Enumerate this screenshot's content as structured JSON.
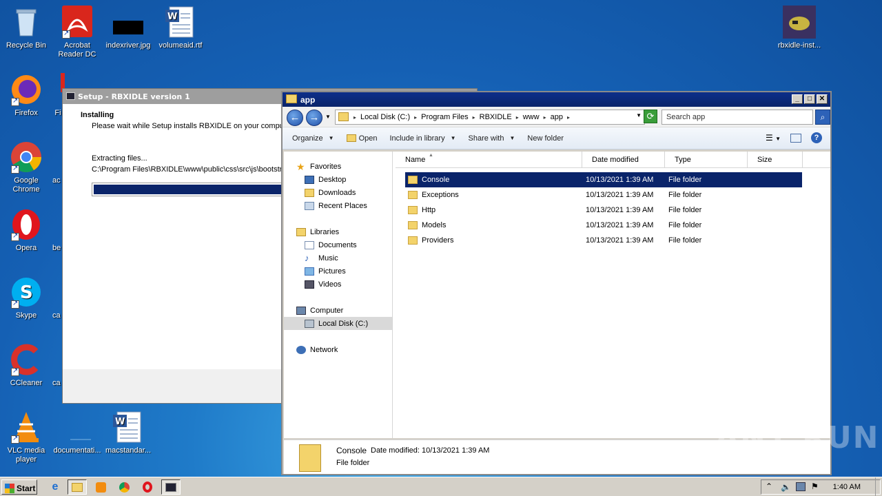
{
  "desktop_icons": [
    {
      "id": "recycle",
      "label": "Recycle Bin",
      "icon": "recycle-bin-icon"
    },
    {
      "id": "acrobat",
      "label": "Acrobat Reader DC",
      "icon": "acrobat-icon"
    },
    {
      "id": "indexriver",
      "label": "indexriver.jpg",
      "icon": "image-file-icon"
    },
    {
      "id": "volumeaid",
      "label": "volumeaid.rtf",
      "icon": "word-doc-icon"
    },
    {
      "id": "rbxidle",
      "label": "rbxidle-inst...",
      "icon": "installer-icon"
    },
    {
      "id": "firefox",
      "label": "Firefox",
      "icon": "firefox-icon"
    },
    {
      "id": "chrome",
      "label": "Google Chrome",
      "icon": "chrome-icon"
    },
    {
      "id": "opera",
      "label": "Opera",
      "icon": "opera-icon"
    },
    {
      "id": "skype",
      "label": "Skype",
      "icon": "skype-icon"
    },
    {
      "id": "ccleaner",
      "label": "CCleaner",
      "icon": "ccleaner-icon"
    },
    {
      "id": "vlc",
      "label": "VLC media player",
      "icon": "vlc-icon"
    },
    {
      "id": "documentati",
      "label": "documentati...",
      "icon": "file-icon"
    },
    {
      "id": "macstandar",
      "label": "macstandar...",
      "icon": "word-doc-icon"
    },
    {
      "id": "partial_fi",
      "label": "Fi"
    },
    {
      "id": "partial_ac",
      "label": "ac"
    },
    {
      "id": "partial_be",
      "label": "be"
    },
    {
      "id": "partial_ca1",
      "label": "ca"
    },
    {
      "id": "partial_ca2",
      "label": "ca"
    }
  ],
  "setup": {
    "title": "Setup - RBXIDLE version 1",
    "heading": "Installing",
    "subheading": "Please wait while Setup installs RBXIDLE on your computer.",
    "status": "Extracting files...",
    "current_file": "C:\\Program Files\\RBXIDLE\\www\\public\\css\\src\\js\\bootstrap",
    "progress": 0.98
  },
  "explorer": {
    "title": "app",
    "breadcrumbs": [
      "Local Disk (C:)",
      "Program Files",
      "RBXIDLE",
      "www",
      "app"
    ],
    "search_placeholder": "Search app",
    "toolbar": {
      "organize": "Organize",
      "open": "Open",
      "include": "Include in library",
      "share": "Share with",
      "new_folder": "New folder"
    },
    "nav": {
      "favorites": "Favorites",
      "desktop": "Desktop",
      "downloads": "Downloads",
      "recent": "Recent Places",
      "libraries": "Libraries",
      "documents": "Documents",
      "music": "Music",
      "pictures": "Pictures",
      "videos": "Videos",
      "computer": "Computer",
      "local_disk": "Local Disk (C:)",
      "network": "Network"
    },
    "columns": {
      "name": "Name",
      "date": "Date modified",
      "type": "Type",
      "size": "Size"
    },
    "files": [
      {
        "name": "Console",
        "date": "10/13/2021 1:39 AM",
        "type": "File folder"
      },
      {
        "name": "Exceptions",
        "date": "10/13/2021 1:39 AM",
        "type": "File folder"
      },
      {
        "name": "Http",
        "date": "10/13/2021 1:39 AM",
        "type": "File folder"
      },
      {
        "name": "Models",
        "date": "10/13/2021 1:39 AM",
        "type": "File folder"
      },
      {
        "name": "Providers",
        "date": "10/13/2021 1:39 AM",
        "type": "File folder"
      }
    ],
    "details": {
      "name": "Console",
      "modified": "Date modified: 10/13/2021 1:39 AM",
      "type": "File folder"
    }
  },
  "taskbar": {
    "start": "Start",
    "clock": "1:40 AM"
  },
  "watermark": "ANY RUN"
}
